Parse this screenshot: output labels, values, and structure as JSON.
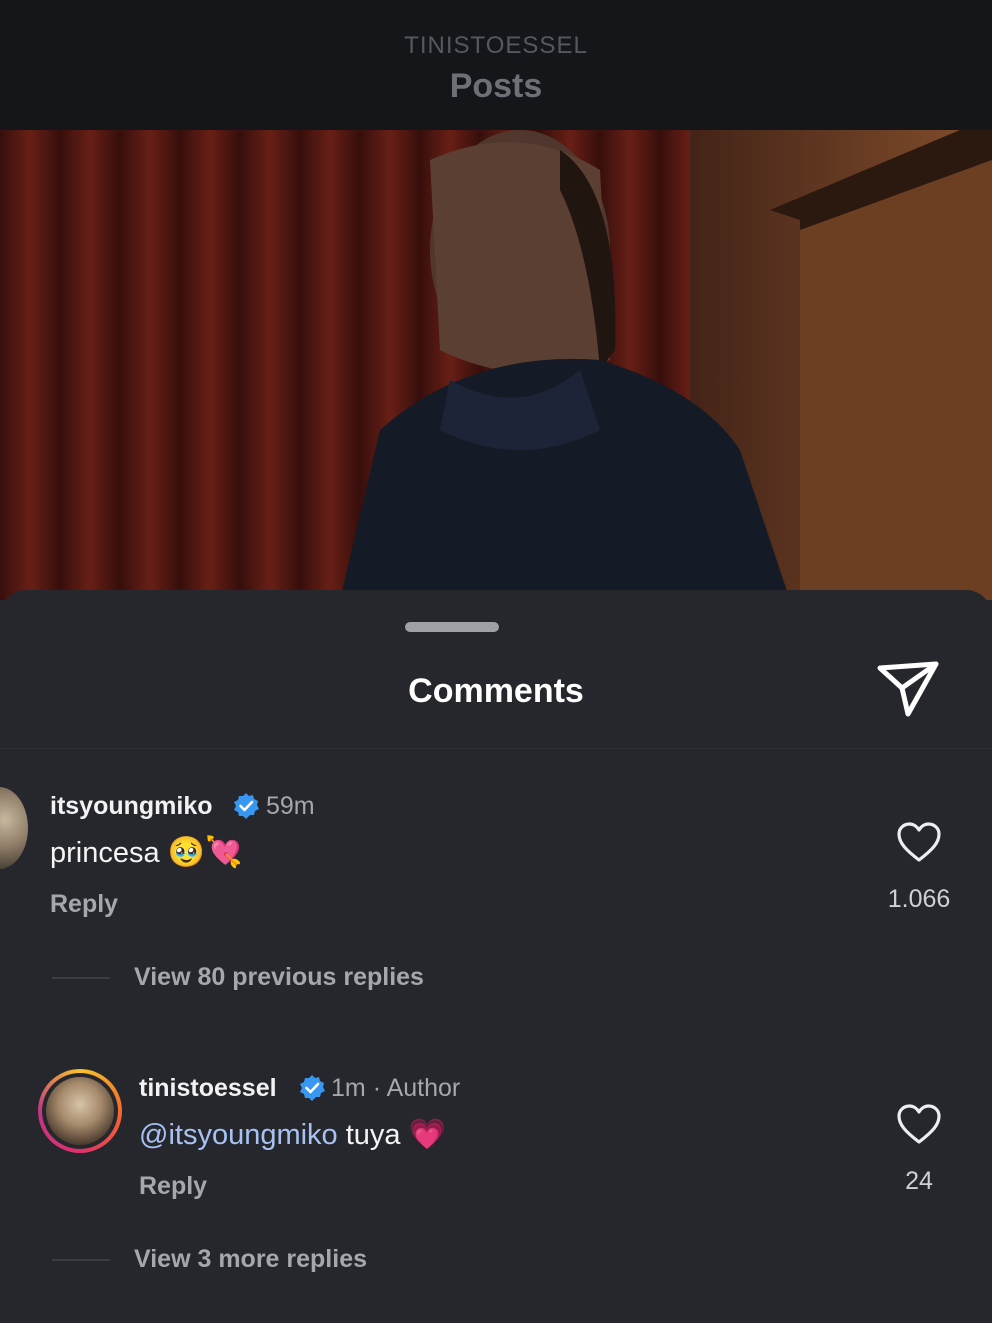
{
  "header": {
    "account": "TINISTOESSEL",
    "title": "Posts"
  },
  "sheet": {
    "title": "Comments",
    "share_icon": "paper-plane-icon"
  },
  "comments": [
    {
      "username": "itsyoungmiko",
      "verified": true,
      "time": "59m",
      "text": "princesa",
      "emojis": "🥹💘",
      "reply_label": "Reply",
      "likes": "1.066",
      "view_replies": "View 80 previous replies"
    },
    {
      "username": "tinistoessel",
      "verified": true,
      "time": "1m",
      "badge": "· Author",
      "mention": "@itsyoungmiko",
      "text": " tuya",
      "emojis": "💗",
      "reply_label": "Reply",
      "likes": "24",
      "view_replies": "View 3 more replies"
    }
  ],
  "colors": {
    "background": "#25272d",
    "header": "#15161a",
    "verified": "#3897f0",
    "mention": "#a7c2f2"
  }
}
